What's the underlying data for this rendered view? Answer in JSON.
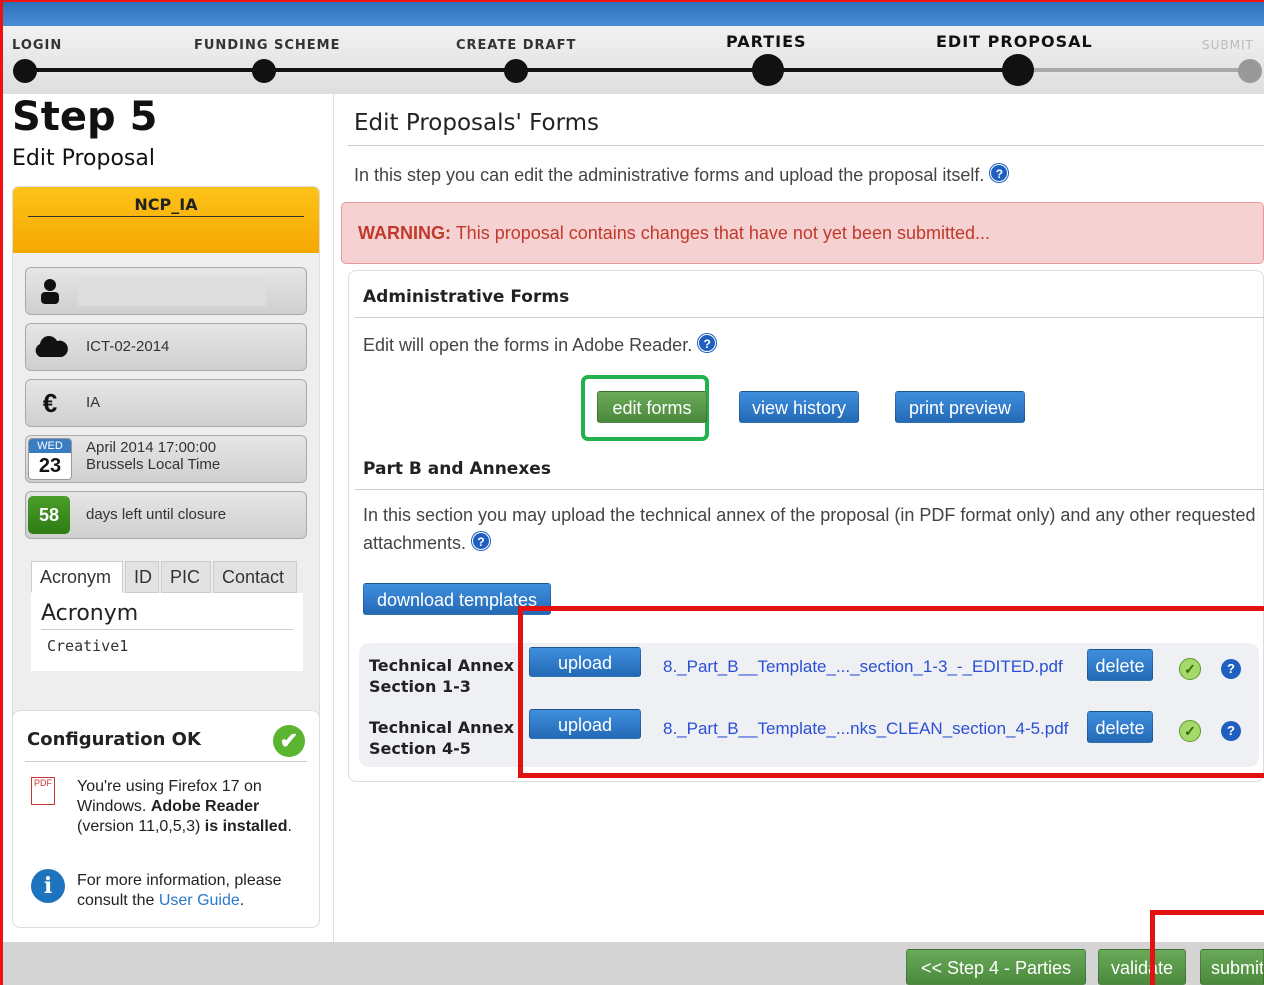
{
  "progress": {
    "steps": [
      {
        "label": "LOGIN"
      },
      {
        "label": "FUNDING SCHEME"
      },
      {
        "label": "CREATE DRAFT"
      },
      {
        "label": "PARTIES"
      },
      {
        "label": "EDIT PROPOSAL"
      },
      {
        "label": "SUBMIT"
      }
    ],
    "current": 5
  },
  "sidebar": {
    "step_number": "Step 5",
    "step_name": "Edit Proposal",
    "proposal_name": "NCP_IA",
    "call": "ICT-02-2014",
    "type": "IA",
    "deadline": {
      "weekday": "WED",
      "day": "23",
      "line1": "April 2014  17:00:00",
      "line2": "Brussels Local Time"
    },
    "days_left": "58",
    "days_left_label": "days left until closure",
    "tabs": [
      "Acronym",
      "ID",
      "PIC",
      "Contact"
    ],
    "tab_heading": "Acronym",
    "tab_value": "Creative1"
  },
  "config": {
    "title": "Configuration OK",
    "line_a": "You're using Firefox 17 on Windows.",
    "line_b": "Adobe Reader",
    "line_c": "(version 11,0,5,3)",
    "line_d": "is installed",
    "more_a": "For more information, please consult the",
    "more_link": "User Guide",
    "pdf_icon": "PDF"
  },
  "main": {
    "title": "Edit Proposals' Forms",
    "intro": "In this step you can edit the administrative forms and upload the proposal itself.",
    "warning_label": "WARNING:",
    "warning_text": "This proposal contains changes that have not yet been submitted...",
    "admin_title": "Administrative Forms",
    "admin_text": "Edit will open the forms in Adobe Reader.",
    "btn_edit_forms": "edit forms",
    "btn_view_history": "view history",
    "btn_print_preview": "print preview",
    "partb_title": "Part B and Annexes",
    "partb_text": "In this section you may upload the technical annex of the proposal (in PDF format only) and any other requested attachments.",
    "btn_download_templates": "download templates",
    "annexes": [
      {
        "label": "Technical Annex Section 1-3",
        "upload": "upload",
        "file": "8._Part_B__Template_..._section_1-3_-_EDITED.pdf",
        "delete": "delete"
      },
      {
        "label": "Technical Annex Section 4-5",
        "upload": "upload",
        "file": "8._Part_B__Template_...nks_CLEAN_section_4-5.pdf",
        "delete": "delete"
      }
    ]
  },
  "footer": {
    "back": "<< Step 4 - Parties",
    "validate": "validate",
    "submit": "submit"
  },
  "colors": {
    "accent": "#2469b5",
    "highlight_red": "#e31212",
    "highlight_green": "#22b14c",
    "warning_bg": "#f6d1d1"
  },
  "icons": {
    "user": "user-icon",
    "call": "cloud-icon",
    "type": "euro-icon",
    "deadline": "calendar-icon",
    "ok": "check-icon",
    "help": "help-icon",
    "info": "info-icon",
    "pdf": "pdf-icon"
  }
}
